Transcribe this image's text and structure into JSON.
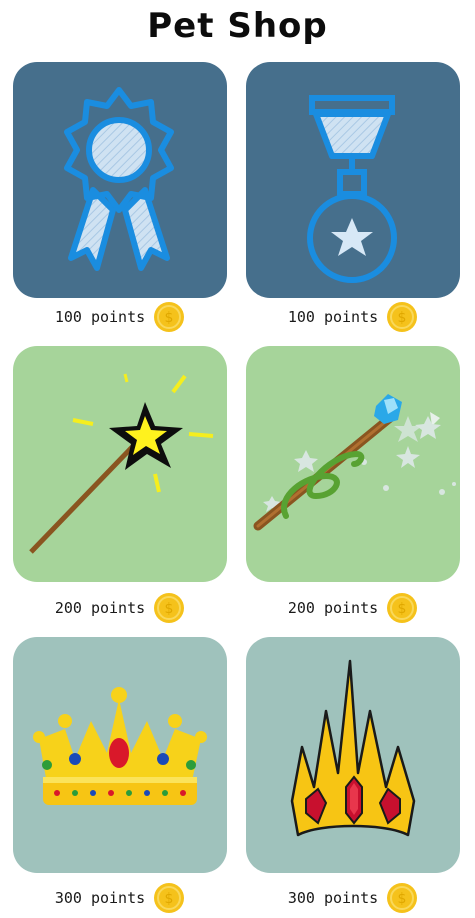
{
  "header": {
    "title": "Pet Shop"
  },
  "colors": {
    "row1_bg": "#466f8c",
    "row2_bg": "#a6d49a",
    "row3_bg": "#9fc2bc",
    "coin": "#f5c21b"
  },
  "items": [
    {
      "name": "Ribbon Award",
      "icon": "award-ribbon-icon",
      "price_label": "100 points"
    },
    {
      "name": "Star Medal",
      "icon": "star-medal-icon",
      "price_label": "100 points"
    },
    {
      "name": "Magic Wand",
      "icon": "magic-wand-icon",
      "price_label": "200 points"
    },
    {
      "name": "Snake Staff",
      "icon": "snake-staff-icon",
      "price_label": "200 points"
    },
    {
      "name": "Jeweled Crown",
      "icon": "jeweled-crown-icon",
      "price_label": "300 points"
    },
    {
      "name": "Ice Crown",
      "icon": "spiked-crown-icon",
      "price_label": "300 points"
    }
  ]
}
